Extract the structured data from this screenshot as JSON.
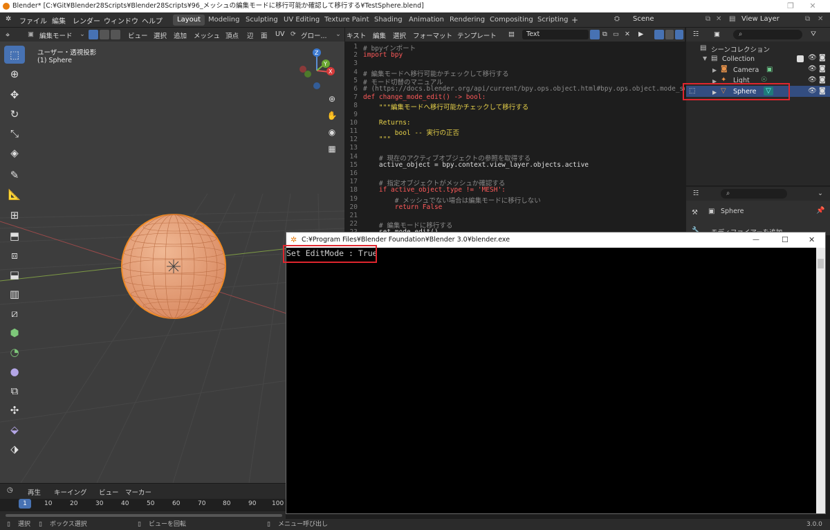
{
  "window": {
    "title": "Blender* [C:¥Git¥Blender28Scripts¥Blender28Scripts¥96_メッシュの編集モードに移行可能か確認して移行する¥TestSphere.blend]",
    "restore_glyph": "❐",
    "close_glyph": "✕"
  },
  "menu": {
    "items": [
      "ファイル",
      "編集",
      "レンダー",
      "ウィンドウ",
      "ヘルプ"
    ]
  },
  "workspaces": [
    "Layout",
    "Modeling",
    "Sculpting",
    "UV Editing",
    "Texture Paint",
    "Shading",
    "Animation",
    "Rendering",
    "Compositing",
    "Scripting",
    "+"
  ],
  "scene": {
    "name": "Scene",
    "view_layer": "View Layer"
  },
  "viewport": {
    "mode": "編集モード",
    "menus": [
      "ビュー",
      "選択",
      "追加",
      "メッシュ",
      "頂点",
      "辺",
      "面",
      "UV"
    ],
    "orientation": "グロー...",
    "view_name": "ユーザー・透視投影",
    "object_label": "(1) Sphere",
    "gizmo": {
      "x": "X",
      "y": "Y",
      "z": "Z"
    }
  },
  "editor": {
    "menus": [
      "キスト",
      "編集",
      "選択",
      "フォーマット",
      "テンプレート"
    ],
    "text_name": "Text",
    "lines": [
      {
        "n": "1",
        "t": "# bpyインポート",
        "c": "cm"
      },
      {
        "n": "2",
        "t": "import bpy",
        "c": "kw"
      },
      {
        "n": "3",
        "t": "",
        "c": ""
      },
      {
        "n": "4",
        "t": "# 編集モードへ移行可能かチェックして移行する",
        "c": "cm"
      },
      {
        "n": "5",
        "t": "# モード切替のマニュアル",
        "c": "cm"
      },
      {
        "n": "6",
        "t": "# (https://docs.blender.org/api/current/bpy.ops.object.html#bpy.ops.object.mode_set)",
        "c": "cm"
      },
      {
        "n": "7",
        "t": "def change_mode_edit() -> bool:",
        "c": "kw"
      },
      {
        "n": "8",
        "t": "    \"\"\"編集モードへ移行可能かチェックして移行する",
        "c": "st"
      },
      {
        "n": "9",
        "t": "",
        "c": ""
      },
      {
        "n": "10",
        "t": "    Returns:",
        "c": "st"
      },
      {
        "n": "11",
        "t": "        bool -- 実行の正否",
        "c": "st"
      },
      {
        "n": "12",
        "t": "    \"\"\"",
        "c": "st"
      },
      {
        "n": "13",
        "t": "",
        "c": ""
      },
      {
        "n": "14",
        "t": "    # 現在のアクティブオブジェクトの参照を取得する",
        "c": "cm"
      },
      {
        "n": "15",
        "t": "    active_object = bpy.context.view_layer.objects.active",
        "c": "fn"
      },
      {
        "n": "16",
        "t": "",
        "c": ""
      },
      {
        "n": "17",
        "t": "    # 指定オブジェクトがメッシュか確認する",
        "c": "cm"
      },
      {
        "n": "18",
        "t": "    if active_object.type != 'MESH':",
        "c": "kw"
      },
      {
        "n": "19",
        "t": "        # メッシュでない場合は編集モードに移行しない",
        "c": "cm"
      },
      {
        "n": "20",
        "t": "        return False",
        "c": "kw"
      },
      {
        "n": "21",
        "t": "",
        "c": ""
      },
      {
        "n": "22",
        "t": "    # 編集モードに移行する",
        "c": "cm"
      },
      {
        "n": "23",
        "t": "    set_mode_edit()",
        "c": "fn"
      }
    ]
  },
  "outliner": {
    "root": "シーンコレクション",
    "collection": "Collection",
    "items": [
      "Camera",
      "Light",
      "Sphere"
    ]
  },
  "properties": {
    "object_name": "Sphere",
    "modifier_add": "モディファイアーを追加"
  },
  "console": {
    "title": "C:¥Program Files¥Blender Foundation¥Blender 3.0¥blender.exe",
    "output": "Set EditMode : True",
    "min_glyph": "—",
    "max_glyph": "☐",
    "close_glyph": "✕"
  },
  "timeline": {
    "menus": [
      "再生",
      "キーイング",
      "ビュー",
      "マーカー"
    ],
    "current_frame": "1",
    "frames": [
      "10",
      "20",
      "30",
      "40",
      "50",
      "60",
      "70",
      "80",
      "90",
      "100"
    ]
  },
  "status": {
    "items": [
      "選択",
      "ボックス選択",
      "ビューを回転",
      "メニュー呼び出し"
    ],
    "version": "3.0.0"
  },
  "colors": {
    "accent": "#4772b3",
    "highlight": "#e0262e",
    "mesh": "#e9956a",
    "selected_edge": "#f08a24"
  }
}
